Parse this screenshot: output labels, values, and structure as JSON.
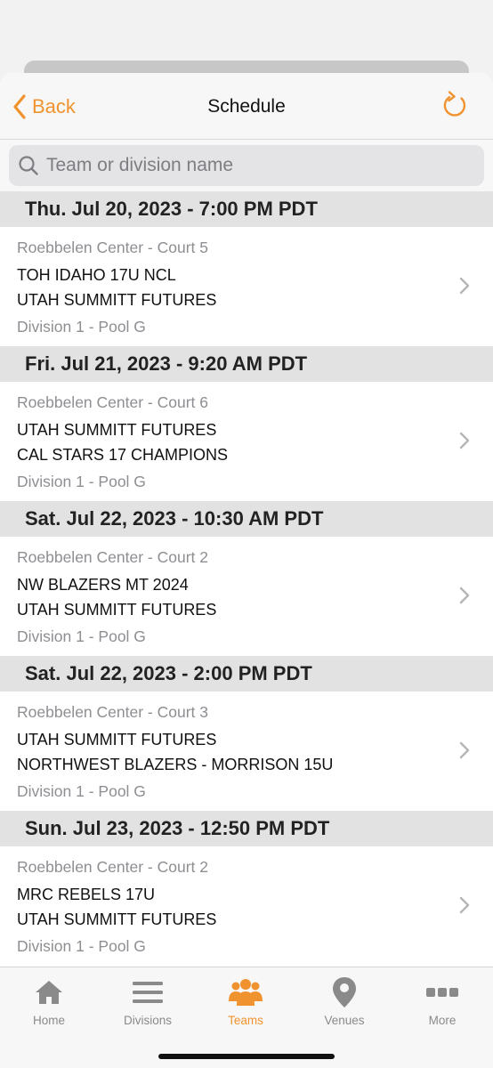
{
  "colors": {
    "accent": "#f0932e",
    "inactive": "#8a8a8a"
  },
  "navbar": {
    "back_label": "Back",
    "title": "Schedule",
    "refresh_icon": "refresh-icon"
  },
  "search": {
    "placeholder": "Team or division name",
    "value": ""
  },
  "schedule": [
    {
      "header": "Thu. Jul 20, 2023 - 7:00 PM PDT",
      "venue": "Roebbelen Center - Court 5",
      "team1": "TOH IDAHO 17U NCL",
      "team2": "UTAH SUMMITT FUTURES",
      "division": "Division 1 - Pool G"
    },
    {
      "header": "Fri. Jul 21, 2023 - 9:20 AM PDT",
      "venue": "Roebbelen Center - Court 6",
      "team1": "UTAH SUMMITT FUTURES",
      "team2": "CAL STARS 17 CHAMPIONS",
      "division": "Division 1 - Pool G"
    },
    {
      "header": "Sat. Jul 22, 2023 - 10:30 AM PDT",
      "venue": "Roebbelen Center - Court 2",
      "team1": "NW BLAZERS MT 2024",
      "team2": "UTAH SUMMITT FUTURES",
      "division": "Division 1 - Pool G"
    },
    {
      "header": "Sat. Jul 22, 2023 - 2:00 PM PDT",
      "venue": "Roebbelen Center - Court 3",
      "team1": "UTAH SUMMITT FUTURES",
      "team2": "NORTHWEST BLAZERS - MORRISON 15U",
      "division": "Division 1 - Pool G"
    },
    {
      "header": "Sun. Jul 23, 2023 - 12:50 PM PDT",
      "venue": "Roebbelen Center - Court 2",
      "team1": "MRC REBELS 17U",
      "team2": "UTAH SUMMITT FUTURES",
      "division": "Division 1 - Pool G"
    }
  ],
  "tabs": [
    {
      "label": "Home",
      "icon": "home-icon",
      "active": false
    },
    {
      "label": "Divisions",
      "icon": "list-icon",
      "active": false
    },
    {
      "label": "Teams",
      "icon": "people-icon",
      "active": true
    },
    {
      "label": "Venues",
      "icon": "map-pin-icon",
      "active": false
    },
    {
      "label": "More",
      "icon": "more-icon",
      "active": false
    }
  ]
}
